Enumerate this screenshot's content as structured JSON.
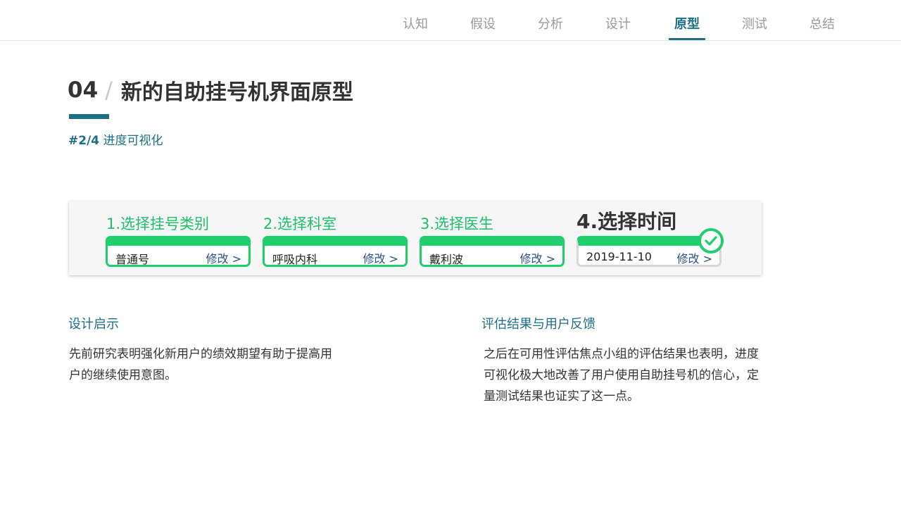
{
  "nav": {
    "items": [
      "认知",
      "假设",
      "分析",
      "设计",
      "原型",
      "测试",
      "总结"
    ],
    "active": "原型"
  },
  "header": {
    "number": "04",
    "separator": "/",
    "title": "新的自助挂号机界面原型",
    "subtitle_hash": "#",
    "subtitle_progress": "2/4",
    "subtitle_text": "进度可视化"
  },
  "prototype": {
    "steps": [
      {
        "label": "1.选择挂号类别",
        "value": "普通号",
        "edit": "修改 >"
      },
      {
        "label": "2.选择科室",
        "value": "呼吸内科",
        "edit": "修改 >"
      },
      {
        "label": "3.选择医生",
        "value": "戴利波",
        "edit": "修改 >"
      },
      {
        "label": "4.选择时间",
        "value": "2019-11-10",
        "edit": "修改 >"
      }
    ],
    "current_step": 4,
    "complete_icon": "check-circle-icon",
    "accent_color": "#1fce6d"
  },
  "insight": {
    "title": "设计启示",
    "body": "先前研究表明强化新用户的绩效期望有助于提高用户的继续使用意图。"
  },
  "feedback": {
    "title": "评估结果与用户反馈",
    "body": "之后在可用性评估焦点小组的评估结果也表明，进度可视化极大地改善了用户使用自助挂号机的信心，定量测试结果也证实了这一点。"
  },
  "colors": {
    "brand": "#1e6f86",
    "success": "#1fce6d",
    "muted": "#9a9a9a"
  }
}
